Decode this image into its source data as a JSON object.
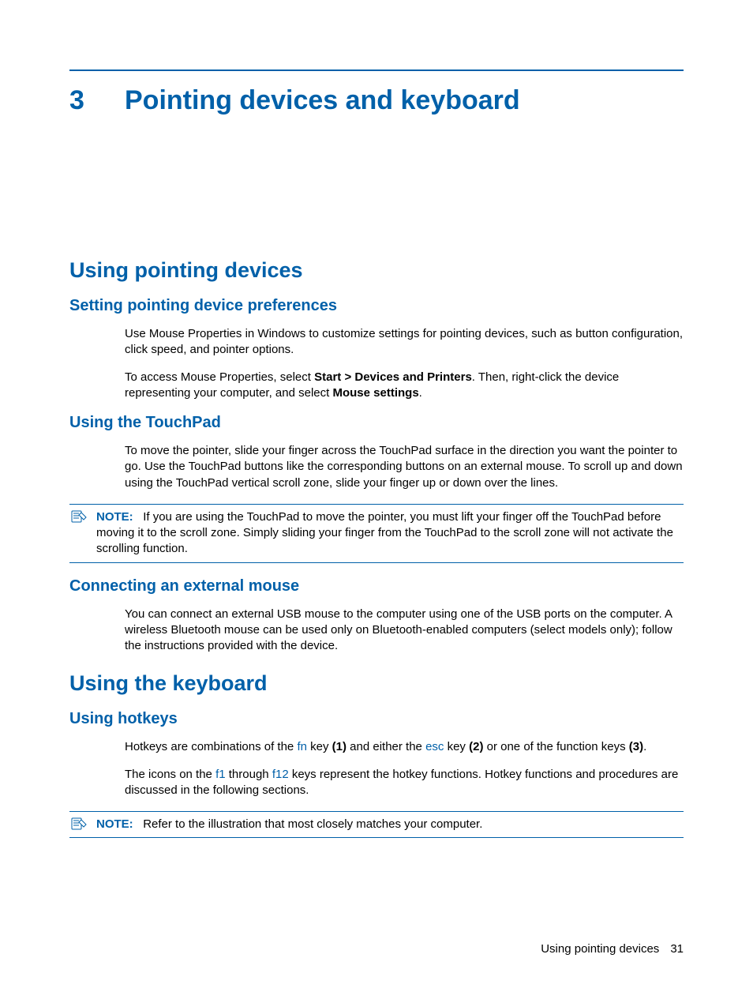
{
  "chapter": {
    "num": "3",
    "title": "Pointing devices and keyboard"
  },
  "s1": {
    "h": "Using pointing devices",
    "a": {
      "h": "Setting pointing device preferences",
      "p1": "Use Mouse Properties in Windows to customize settings for pointing devices, such as button configuration, click speed, and pointer options.",
      "p2a": "To access Mouse Properties, select ",
      "p2b": "Start > Devices and Printers",
      "p2c": ". Then, right-click the device representing your computer, and select ",
      "p2d": "Mouse settings",
      "p2e": "."
    },
    "b": {
      "h": "Using the TouchPad",
      "p1": "To move the pointer, slide your finger across the TouchPad surface in the direction you want the pointer to go. Use the TouchPad buttons like the corresponding buttons on an external mouse. To scroll up and down using the TouchPad vertical scroll zone, slide your finger up or down over the lines.",
      "note_label": "NOTE:",
      "note": "If you are using the TouchPad to move the pointer, you must lift your finger off the TouchPad before moving it to the scroll zone. Simply sliding your finger from the TouchPad to the scroll zone will not activate the scrolling function."
    },
    "c": {
      "h": "Connecting an external mouse",
      "p1": "You can connect an external USB mouse to the computer using one of the USB ports on the computer. A wireless Bluetooth mouse can be used only on Bluetooth-enabled computers (select models only); follow the instructions provided with the device."
    }
  },
  "s2": {
    "h": "Using the keyboard",
    "a": {
      "h": "Using hotkeys",
      "p1a": "Hotkeys are combinations of the ",
      "fn": "fn",
      "p1b": " key ",
      "k1": "(1)",
      "p1c": " and either the ",
      "esc": "esc",
      "p1d": " key ",
      "k2": "(2)",
      "p1e": " or one of the function keys ",
      "k3": "(3)",
      "p1f": ".",
      "p2a": "The icons on the ",
      "f1": "f1",
      "p2b": " through ",
      "f12": "f12",
      "p2c": " keys represent the hotkey functions. Hotkey functions and procedures are discussed in the following sections.",
      "note_label": "NOTE:",
      "note": "Refer to the illustration that most closely matches your computer."
    }
  },
  "footer": {
    "section": "Using pointing devices",
    "page": "31"
  }
}
